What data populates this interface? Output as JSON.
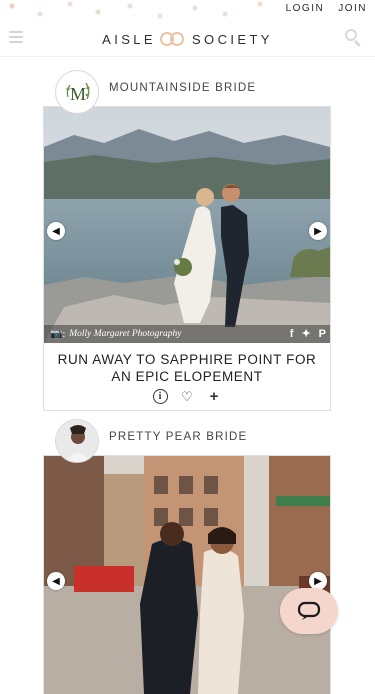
{
  "top_links": {
    "login": "LOGIN",
    "join": "JOIN"
  },
  "brand": {
    "left": "AISLE",
    "right": "SOCIETY"
  },
  "posts": [
    {
      "vendor": "MOUNTAINSIDE BRIDE",
      "credit": "Molly Margaret Photography",
      "title": "RUN AWAY TO SAPPHIRE POINT FOR AN EPIC ELOPEMENT",
      "avatar_initials": "M"
    },
    {
      "vendor": "PRETTY PEAR BRIDE"
    }
  ],
  "colors": {
    "accent": "#ecc2a5",
    "chat": "#f4d6cc"
  },
  "icons": {
    "menu": "hamburger-icon",
    "search": "search-icon",
    "camera": "camera-icon",
    "facebook": "facebook-icon",
    "twitter": "twitter-icon",
    "pinterest": "pinterest-icon",
    "info": "info-icon",
    "heart": "heart-icon",
    "add": "plus-icon",
    "chat": "chat-icon"
  }
}
